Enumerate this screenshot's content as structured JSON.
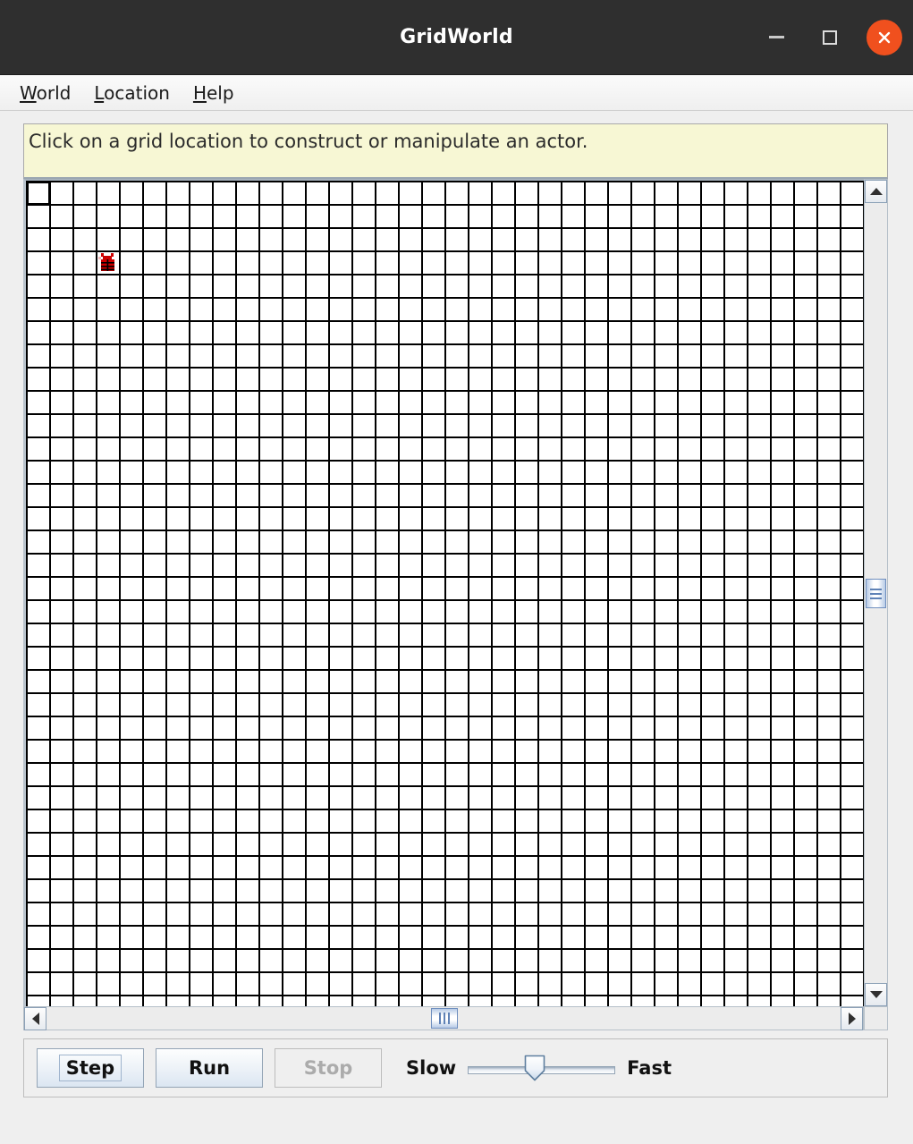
{
  "window": {
    "title": "GridWorld",
    "minimize_label": "minimize",
    "maximize_label": "maximize",
    "close_label": "close"
  },
  "menubar": {
    "items": [
      {
        "label": "World",
        "mnemonic": "W",
        "rest": "orld"
      },
      {
        "label": "Location",
        "mnemonic": "L",
        "rest": "ocation"
      },
      {
        "label": "Help",
        "mnemonic": "H",
        "rest": "elp"
      }
    ]
  },
  "message_bar": {
    "text": "Click on a grid location to construct or manipulate an actor.",
    "background_color": "#f7f7d4"
  },
  "grid": {
    "cols": 36,
    "rows": 36,
    "cell_size": 26,
    "line_color": "#000000",
    "background_color": "#ffffff",
    "selected_cell": {
      "row": 0,
      "col": 0
    },
    "actors": [
      {
        "type": "bug",
        "row": 3,
        "col": 3,
        "color": "#cc0000",
        "direction": "north"
      }
    ]
  },
  "scrollbars": {
    "vertical": {
      "up_arrow": "scroll-up",
      "down_arrow": "scroll-down",
      "thumb_position_pct": 50
    },
    "horizontal": {
      "left_arrow": "scroll-left",
      "right_arrow": "scroll-right",
      "thumb_position_pct": 50
    }
  },
  "controls": {
    "step_label": "Step",
    "run_label": "Run",
    "stop_label": "Stop",
    "stop_enabled": false,
    "step_focused": true,
    "slider": {
      "min_label": "Slow",
      "max_label": "Fast",
      "value_pct": 45
    }
  }
}
